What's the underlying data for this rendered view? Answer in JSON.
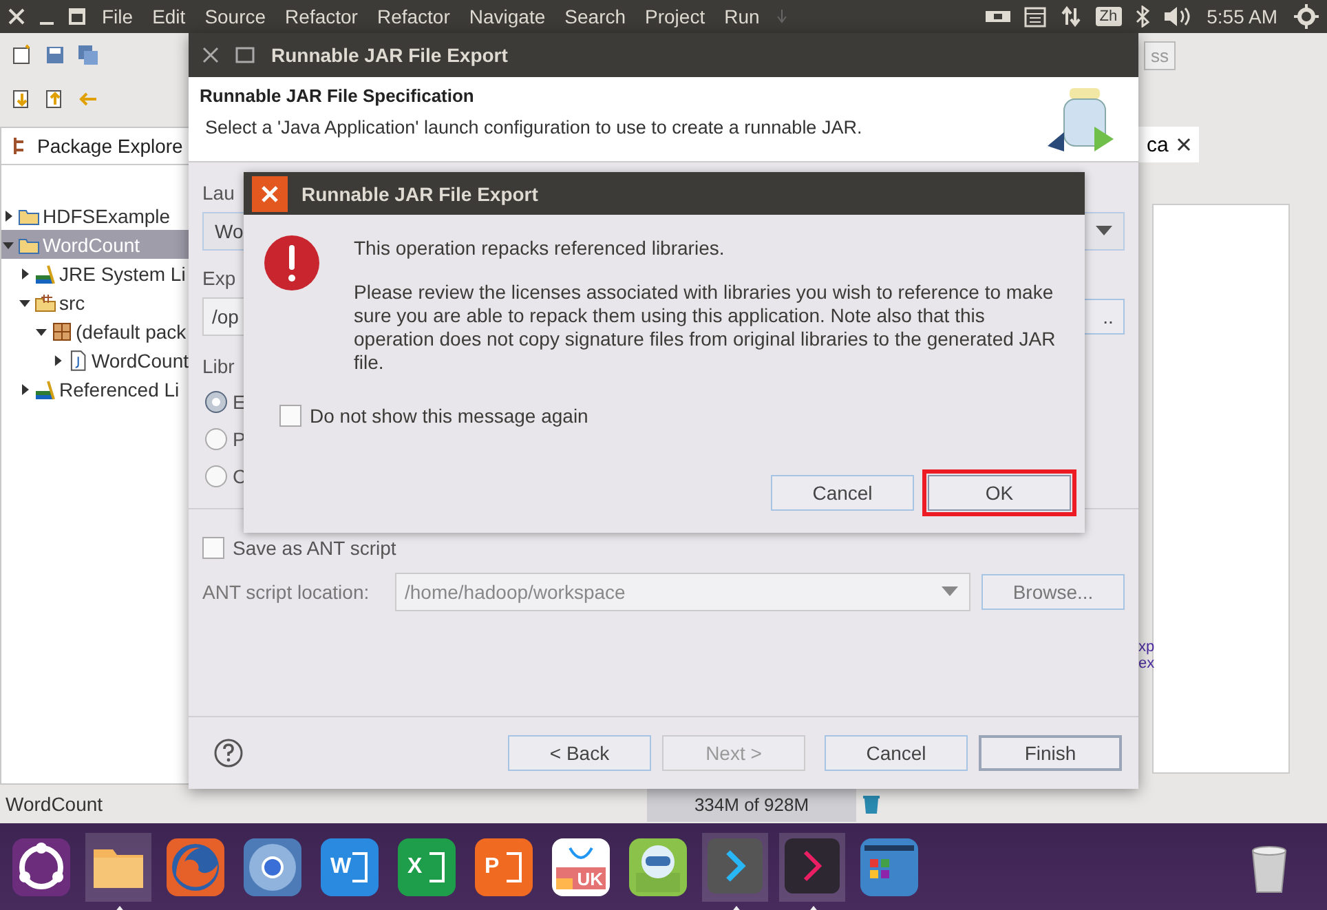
{
  "top_bar": {
    "menus": [
      "File",
      "Edit",
      "Source",
      "Refactor",
      "Refactor",
      "Navigate",
      "Search",
      "Project",
      "Run"
    ],
    "input_method": "Zh",
    "clock": "5:55 AM"
  },
  "eclipse": {
    "toolbar_partial": "ss",
    "package_explorer": {
      "title": "Package Explore",
      "tree": [
        {
          "label": "HDFSExample",
          "kind": "project",
          "expanded": false,
          "selected": false
        },
        {
          "label": "WordCount",
          "kind": "project",
          "expanded": true,
          "selected": true,
          "children": [
            {
              "label": "JRE System Li",
              "kind": "library",
              "expanded": false,
              "selected": false
            },
            {
              "label": "src",
              "kind": "source-folder",
              "expanded": true,
              "selected": false,
              "children": [
                {
                  "label": "(default pack",
                  "kind": "package",
                  "expanded": true,
                  "selected": false,
                  "children": [
                    {
                      "label": "WordCount",
                      "kind": "java-file",
                      "expanded": false,
                      "selected": false
                    }
                  ]
                }
              ]
            },
            {
              "label": "Referenced Li",
              "kind": "library",
              "expanded": false,
              "selected": false
            }
          ]
        }
      ]
    },
    "right_tab": "ca",
    "right_fragments": [
      "xp",
      "ex"
    ],
    "status_bar": {
      "selection": "WordCount",
      "heap": "334M of 928M"
    }
  },
  "wizard": {
    "title": "Runnable JAR File Export",
    "heading": "Runnable JAR File Specification",
    "description": "Select a 'Java Application' launch configuration to use to create a runnable JAR.",
    "launch_label": "Lau",
    "launch_value": "Wo",
    "export_label": "Exp",
    "export_value": "/op",
    "export_button": "..",
    "library_label": "Libr",
    "library_options": [
      {
        "label": "E",
        "selected": true
      },
      {
        "label": "P",
        "selected": false
      },
      {
        "label": "C",
        "selected": false
      }
    ],
    "save_ant": {
      "label": "Save as ANT script",
      "checked": false
    },
    "ant_location": {
      "label": "ANT script location:",
      "value": "/home/hadoop/workspace",
      "disabled": true,
      "button": "Browse..."
    },
    "buttons": [
      {
        "label": "< Back",
        "disabled": false,
        "default": false
      },
      {
        "label": "Next >",
        "disabled": true,
        "default": false
      },
      {
        "label": "Cancel",
        "disabled": false,
        "default": false
      },
      {
        "label": "Finish",
        "disabled": false,
        "default": true
      }
    ]
  },
  "alert": {
    "title": "Runnable JAR File Export",
    "message": "This operation repacks referenced libraries.",
    "details": "Please review the licenses associated with libraries you wish to reference to make sure you are able to repack them using this application. Note also that this operation does not copy signature files from original libraries to the generated JAR file.",
    "dont_show": {
      "label": "Do not show this message again",
      "checked": false
    },
    "buttons": [
      {
        "label": "Cancel",
        "highlighted": false
      },
      {
        "label": "OK",
        "highlighted": true
      }
    ]
  },
  "dock": [
    {
      "kind": "ubuntu",
      "running": false
    },
    {
      "kind": "files",
      "running": true
    },
    {
      "kind": "firefox",
      "running": false
    },
    {
      "kind": "chromium",
      "running": false
    },
    {
      "kind": "word",
      "glyph": "W",
      "running": false
    },
    {
      "kind": "excel",
      "glyph": "X",
      "running": false
    },
    {
      "kind": "powerpoint",
      "glyph": "P",
      "running": false
    },
    {
      "kind": "store",
      "glyph": "UK",
      "running": false
    },
    {
      "kind": "robot",
      "running": false
    },
    {
      "kind": "prompt",
      "running": true
    },
    {
      "kind": "terminal",
      "running": true
    },
    {
      "kind": "apps",
      "running": false
    },
    {
      "kind": "trash",
      "running": false
    }
  ]
}
